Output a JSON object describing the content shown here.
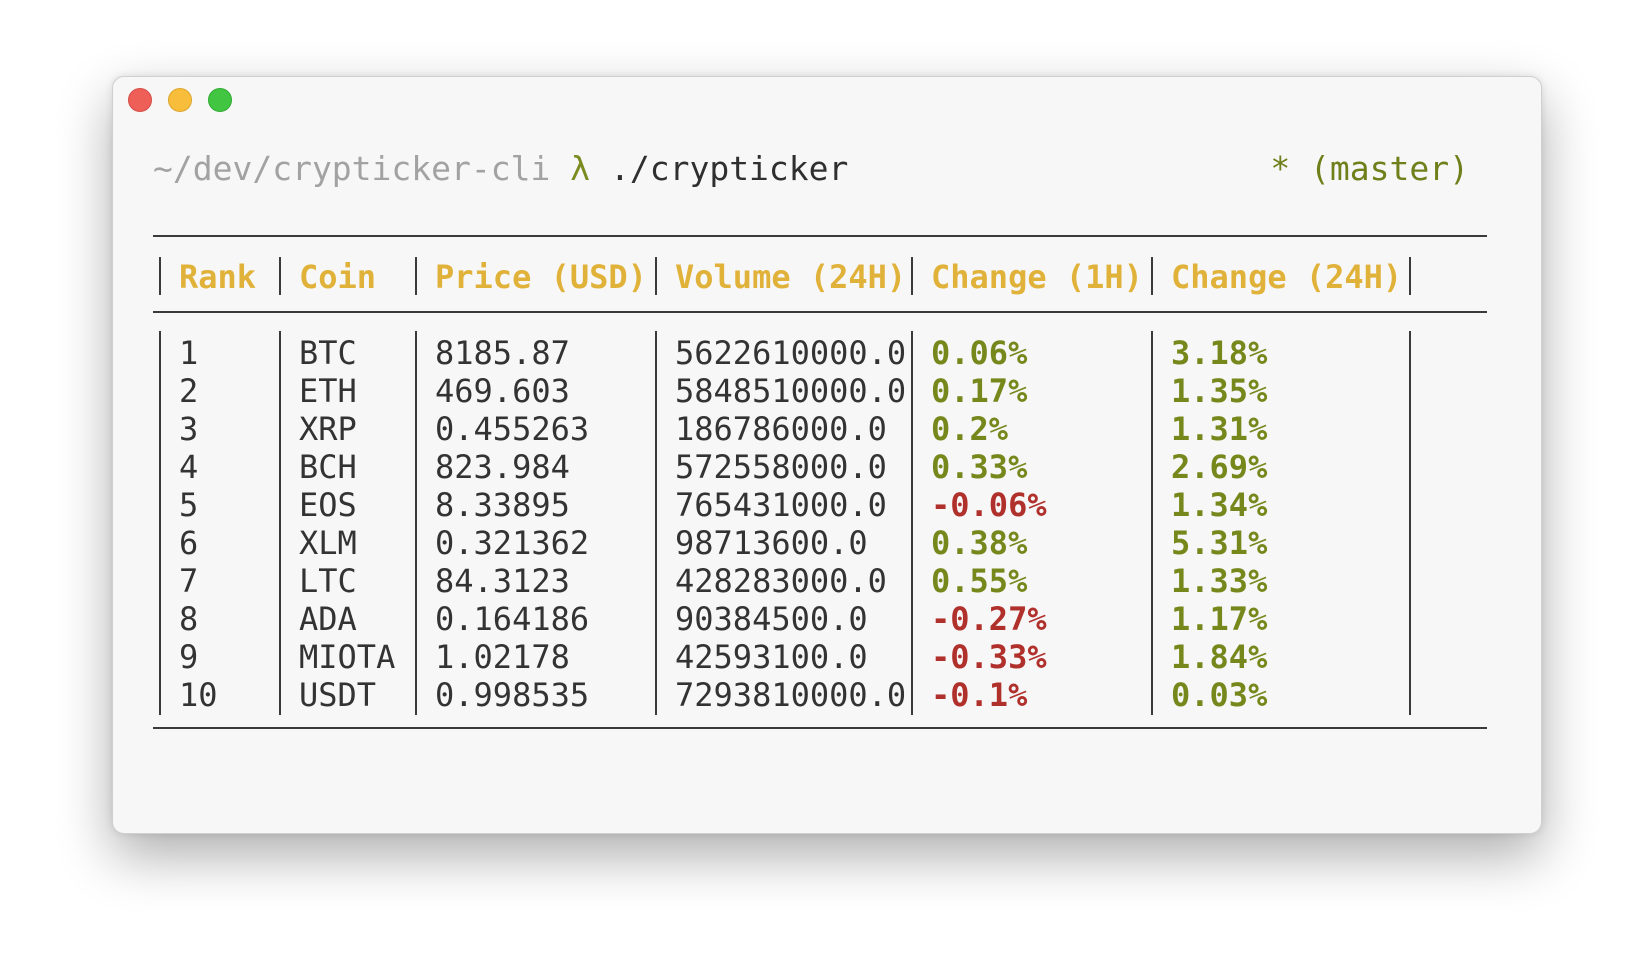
{
  "terminal": {
    "prompt_path": "~/dev/crypticker-cli",
    "prompt_symbol": "λ",
    "command": "./crypticker",
    "git_status": "* (master)"
  },
  "table": {
    "columns": [
      "Rank",
      "Coin",
      "Price (USD)",
      "Volume (24H)",
      "Change (1H)",
      "Change (24H)"
    ],
    "rows": [
      [
        "1",
        "BTC",
        "8185.87",
        "5622610000.0",
        "0.06%",
        "3.18%"
      ],
      [
        "2",
        "ETH",
        "469.603",
        "5848510000.0",
        "0.17%",
        "1.35%"
      ],
      [
        "3",
        "XRP",
        "0.455263",
        "186786000.0",
        "0.2%",
        "1.31%"
      ],
      [
        "4",
        "BCH",
        "823.984",
        "572558000.0",
        "0.33%",
        "2.69%"
      ],
      [
        "5",
        "EOS",
        "8.33895",
        "765431000.0",
        "-0.06%",
        "1.34%"
      ],
      [
        "6",
        "XLM",
        "0.321362",
        "98713600.0",
        "0.38%",
        "5.31%"
      ],
      [
        "7",
        "LTC",
        "84.3123",
        "428283000.0",
        "0.55%",
        "1.33%"
      ],
      [
        "8",
        "ADA",
        "0.164186",
        "90384500.0",
        "-0.27%",
        "1.17%"
      ],
      [
        "9",
        "MIOTA",
        "1.02178",
        "42593100.0",
        "-0.33%",
        "1.84%"
      ],
      [
        "10",
        "USDT",
        "0.998535",
        "7293810000.0",
        "-0.1%",
        "0.03%"
      ]
    ]
  },
  "colors": {
    "header": "#e1b23a",
    "positive": "#76881c",
    "negative": "#b0302c",
    "path": "#a2a2a2",
    "text": "#333333",
    "window_bg": "#f7f7f7"
  }
}
